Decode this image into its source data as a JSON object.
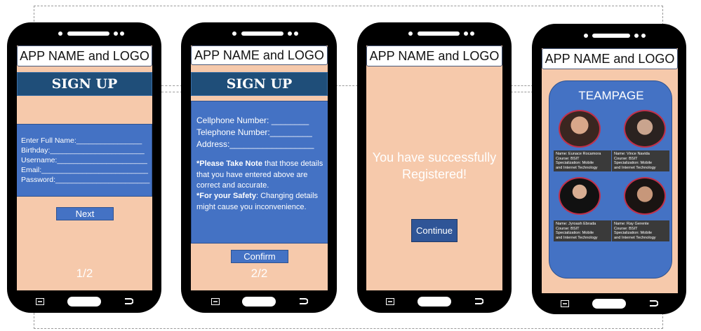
{
  "app_name_label": "APP NAME and LOGO",
  "signup_title": "SIGN UP",
  "screen1": {
    "fields": [
      "Enter Full Name:________________",
      "Birthday:_______________________",
      "Username:______________________",
      "Email:__________________________",
      "Password:_______________________"
    ],
    "next_label": "Next",
    "page_indicator": "1/2"
  },
  "screen2": {
    "fields": [
      "Cellphone Number: ________",
      "Telephone Number:_________",
      "Address:__________________"
    ],
    "note_bold_1": "*Please Take Note",
    "note_text_1": " that  those details that you have entered above are correct and accurate.",
    "note_bold_2": "*For your Safety",
    "note_text_2": ": Changing details might cause you inconvenience.",
    "confirm_label": "Confirm",
    "page_indicator": "2/2"
  },
  "screen3": {
    "message_line1": "You have successfully",
    "message_line2": "Registered!",
    "continue_label": "Continue"
  },
  "screen4": {
    "title": "TEAMPAGE",
    "members": [
      {
        "name": "Name: Eunace Rocamora",
        "course": "Course: BSIT",
        "spec1": "Specialization: Mobile",
        "spec2": "and Internet Technology"
      },
      {
        "name": "Name: Vince Navida",
        "course": "Course: BSIT",
        "spec1": "Specialization: Mobile",
        "spec2": "and Internet Technology"
      },
      {
        "name": "Name: Jyroash Ebrada",
        "course": "Course: BSIT",
        "spec1": "Specialization: Mobile",
        "spec2": "and Internet Technology"
      },
      {
        "name": "Name: Ray Gerente",
        "course": "Course: BSIT",
        "spec1": "Specialization: Mobile",
        "spec2": "and Internet Technology"
      }
    ]
  },
  "colors": {
    "screen_bg": "#f6c9ab",
    "header_band": "#1f4e79",
    "panel_blue": "#4472c4",
    "avatar_border": "#c0304a"
  }
}
